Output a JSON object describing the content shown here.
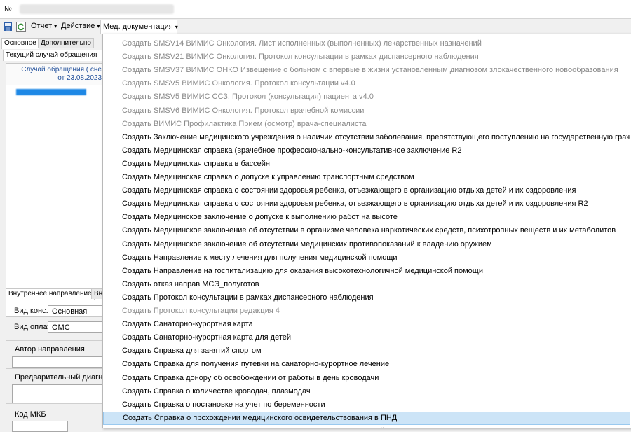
{
  "window": {
    "number_label": "№"
  },
  "toolbar": {
    "items": [
      {
        "label": "Отчет"
      },
      {
        "label": "Действие"
      },
      {
        "label": "Мед. документация"
      }
    ]
  },
  "left_panel": {
    "top_tabs": [
      "Основное",
      "Дополнительно"
    ],
    "case_tab": "Текущий случай обращения",
    "case_header": {
      "line1": "Случай обращения ( сне",
      "line2": "от 23.08.2023"
    },
    "bottom_tabs": [
      "Внутреннее направление",
      "Вн"
    ],
    "fields": {
      "vid_kons_label": "Вид конс.",
      "vid_kons_value": "Основная",
      "vid_oplaty_label": "Вид оплаты",
      "vid_oplaty_value": "ОМС",
      "author_label": "Автор направления",
      "diag_label": "Предварительный диагноз",
      "mkb_label": "Код МКБ"
    }
  },
  "menu": {
    "items": [
      {
        "label": "Создать SMSV14 ВИМИС  Онкология. Лист исполненных (выполненных) лекарственных назначений",
        "enabled": false
      },
      {
        "label": "Создать SMSV21 ВИМИС Онкология. Протокол консультации в рамках диспансерного наблюдения",
        "enabled": false
      },
      {
        "label": "Создать SMSV37 ВИМИС ОНКО Извещение о больном с впервые в жизни установленным диагнозом злокачественного новообразования",
        "enabled": false
      },
      {
        "label": "Создать SMSV5 ВИМИС Онкология. Протокол консультации v4.0",
        "enabled": false
      },
      {
        "label": "Создать SMSV5 ВИМИС ССЗ. Протокол (консультация) пациента v4.0",
        "enabled": false
      },
      {
        "label": "Создать SMSV6 ВИМИС Онкология. Протокол врачебной комиссии",
        "enabled": false
      },
      {
        "label": "Создать ВИМИС Профилактика Прием (осмотр) врача-специалиста",
        "enabled": false
      },
      {
        "label": "Создать Заключение медицинского учреждения о наличии отсутствии заболевания, препятствующего поступлению на государственную гражданскую",
        "enabled": true
      },
      {
        "label": "Создать Медицинская справка (врачебное профессионально-консультативное заключение R2",
        "enabled": true
      },
      {
        "label": "Создать Медицинская справка в бассейн",
        "enabled": true
      },
      {
        "label": "Создать Медицинская справка о допуске к управлению транспортным средством",
        "enabled": true
      },
      {
        "label": "Создать Медицинская справка о состоянии здоровья ребенка, отъезжающего в организацию отдыха детей и их оздоровления",
        "enabled": true
      },
      {
        "label": "Создать Медицинская справка о состоянии здоровья ребенка, отъезжающего в организацию отдыха детей и их оздоровления R2",
        "enabled": true
      },
      {
        "label": "Создать Медицинское заключение о допуске к выполнению работ на высоте",
        "enabled": true
      },
      {
        "label": "Создать Медицинское заключение об отсутствии в организме человека наркотических средств, психотропных веществ и их метаболитов",
        "enabled": true
      },
      {
        "label": "Создать Медицинское заключение об отсутствии медицинских противопоказаний к владению оружием",
        "enabled": true
      },
      {
        "label": "Создать Направление к месту лечения для получения медицинской помощи",
        "enabled": true
      },
      {
        "label": "Создать Направление на госпитализацию для оказания высокотехнологичной медицинской помощи",
        "enabled": true
      },
      {
        "label": "Создать отказ направ МСЭ_полуготов",
        "enabled": true
      },
      {
        "label": "Создать Протокол консультации в рамках диспансерного наблюдения",
        "enabled": true
      },
      {
        "label": "Создать Протокол консультации редакция 4",
        "enabled": false
      },
      {
        "label": "Создать Санаторно-курортная карта",
        "enabled": true
      },
      {
        "label": "Создать Санаторно-курортная карта для детей",
        "enabled": true
      },
      {
        "label": "Создать Справка для занятий спортом",
        "enabled": true
      },
      {
        "label": "Создать Справка для получения путевки на санаторно-курортное лечение",
        "enabled": true
      },
      {
        "label": "Создать Справка донору об освобождении от работы в день кроводачи",
        "enabled": true
      },
      {
        "label": "Создать Справка о количестве кроводач, плазмодач",
        "enabled": true
      },
      {
        "label": "Создать Справка о постановке на учет по беременности",
        "enabled": true
      },
      {
        "label": "Создать Справка о прохождении медицинского освидетельствования в ПНД",
        "enabled": true,
        "highlighted": true
      },
      {
        "label": "Создать Справка о результатах химико-токсикологических исследований",
        "enabled": true
      }
    ]
  },
  "colors": {
    "highlight": "#cce4f7",
    "disabled_text": "#8a8a8a",
    "link_blue": "#1f4e9a"
  }
}
